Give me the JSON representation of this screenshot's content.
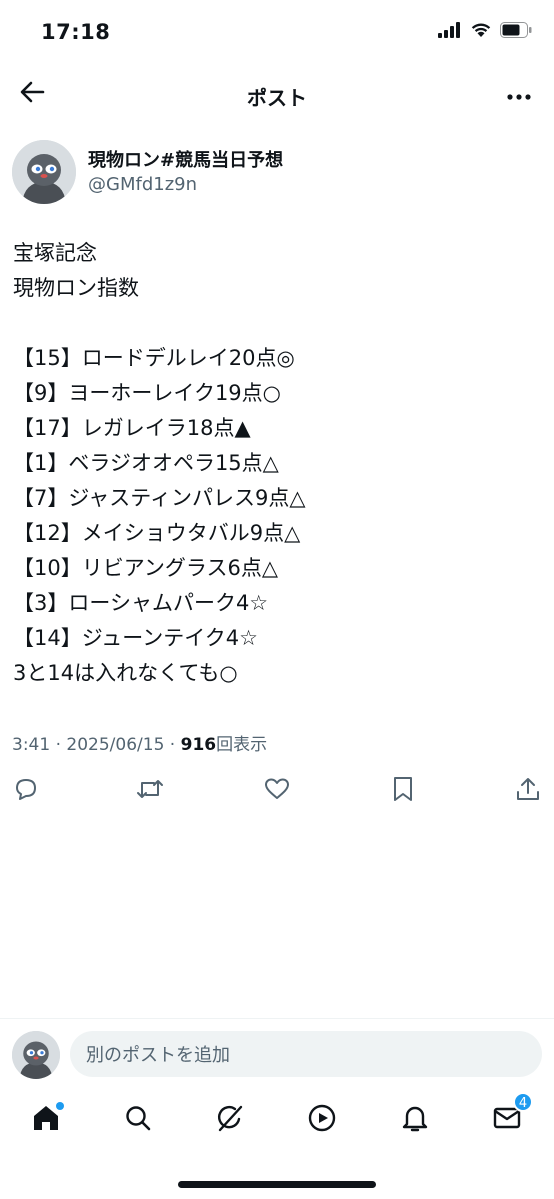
{
  "status_bar": {
    "time": "17:18",
    "icons": [
      "signal-icon",
      "wifi-icon",
      "battery-icon"
    ]
  },
  "nav": {
    "title": "ポスト",
    "back_icon": "back-arrow-icon",
    "more_icon": "more-icon"
  },
  "author": {
    "name": "現物ロン#競馬当日予想",
    "handle": "@GMfd1z9n"
  },
  "post": {
    "lines": [
      "宝塚記念",
      "現物ロン指数",
      "",
      "【15】ロードデルレイ20点◎",
      "【9】ヨーホーレイク19点○",
      "【17】レガレイラ18点▲",
      "【1】ベラジオオペラ15点△",
      "【7】ジャスティンパレス9点△",
      "【12】メイショウタバル9点△",
      "【10】リビアングラス6点△",
      "【3】ローシャムパーク4☆",
      "【14】ジューンテイク4☆",
      "3と14は入れなくても○"
    ]
  },
  "meta": {
    "time": "3:41",
    "separator": "·",
    "date": "2025/06/15",
    "views": "916",
    "views_label": "回表示"
  },
  "actions": [
    "reply-icon",
    "retweet-icon",
    "like-icon",
    "bookmark-icon",
    "share-icon"
  ],
  "reply_bar": {
    "placeholder": "別のポストを追加"
  },
  "tab_bar": {
    "tabs": [
      "home-icon",
      "search-icon",
      "grok-icon",
      "video-icon",
      "notifications-icon",
      "messages-icon"
    ],
    "messages_badge": "4"
  },
  "colors": {
    "text": "#0f1419",
    "secondary": "#536471",
    "accent": "#1d9bf0",
    "input_bg": "#eff3f4"
  }
}
